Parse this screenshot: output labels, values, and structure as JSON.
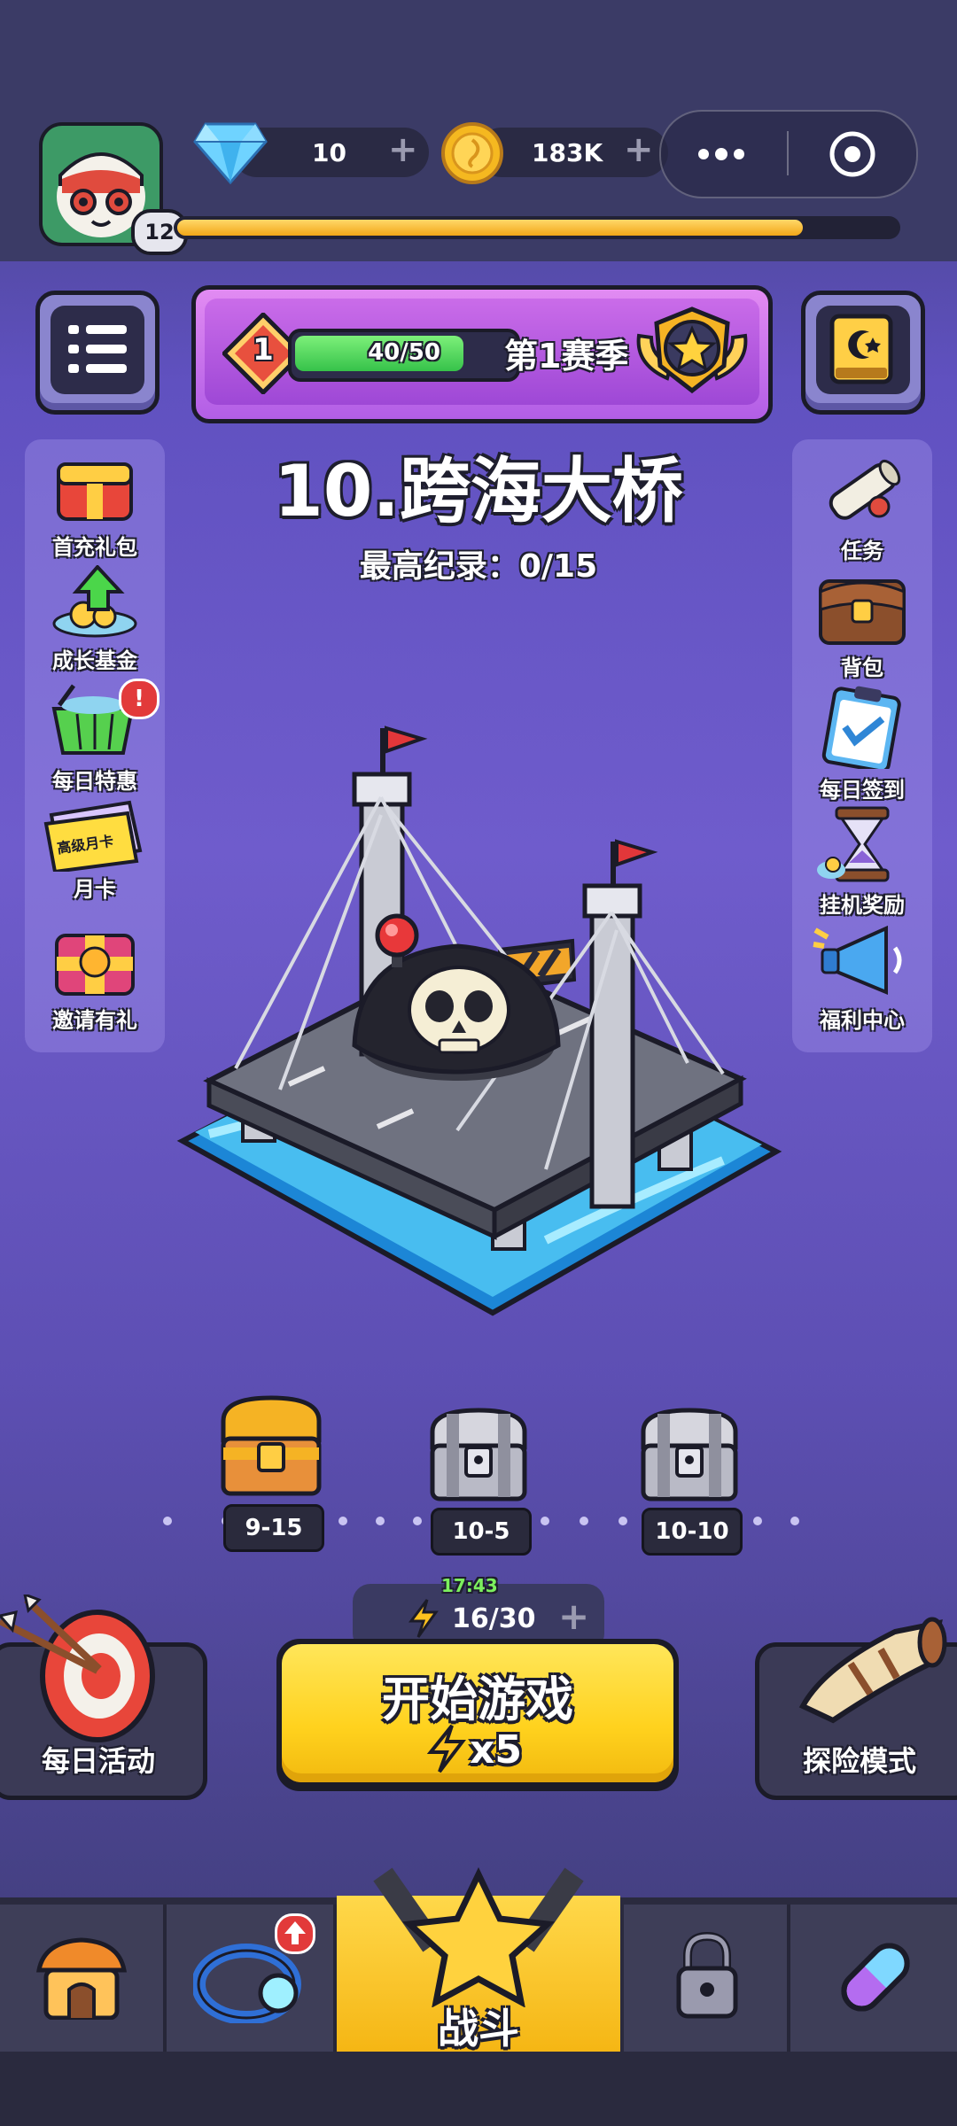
{
  "player": {
    "level": "12",
    "xp_fraction": 0.87
  },
  "currencies": {
    "gems": {
      "icon": "diamond-icon",
      "value": "10"
    },
    "coins": {
      "icon": "coin-icon",
      "value": "183K"
    }
  },
  "season": {
    "rank": "1",
    "progress_text": "40/50",
    "progress_fraction": 0.8,
    "title": "第1赛季"
  },
  "stage": {
    "title": "10.跨海大桥",
    "record": "最高纪录：0/15"
  },
  "left_menu": [
    {
      "label": "首充礼包",
      "icon": "gift-pack-icon"
    },
    {
      "label": "成长基金",
      "icon": "growth-fund-icon"
    },
    {
      "label": "每日特惠",
      "icon": "basket-icon",
      "alert": "!"
    },
    {
      "label": "月卡",
      "icon": "monthly-card-icon",
      "card_text": "高级月卡"
    },
    {
      "label": "邀请有礼",
      "icon": "invite-gift-icon"
    }
  ],
  "right_menu": [
    {
      "label": "任务",
      "icon": "scroll-icon"
    },
    {
      "label": "背包",
      "icon": "backpack-icon"
    },
    {
      "label": "每日签到",
      "icon": "clipboard-icon"
    },
    {
      "label": "挂机奖励",
      "icon": "hourglass-icon"
    },
    {
      "label": "福利中心",
      "icon": "megaphone-icon"
    }
  ],
  "chests": [
    {
      "label": "9-15",
      "state": "open"
    },
    {
      "label": "10-5",
      "state": "locked"
    },
    {
      "label": "10-10",
      "state": "locked"
    }
  ],
  "energy": {
    "timer": "17:43",
    "value": "16/30"
  },
  "start": {
    "label": "开始游戏",
    "cost": "x5"
  },
  "daily_activity": {
    "label": "每日活动"
  },
  "adventure": {
    "label": "探险模式"
  },
  "nav": {
    "battle_label": "战斗"
  },
  "colors": {
    "accent": "#ffd21e",
    "brand_purple": "#6f5ccc",
    "alert": "#e23a3a"
  }
}
